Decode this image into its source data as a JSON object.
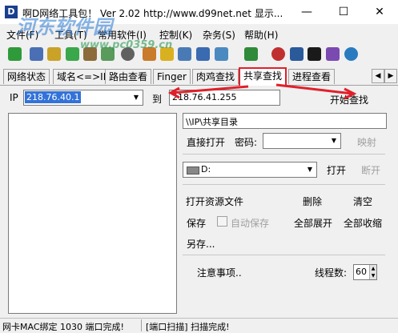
{
  "window": {
    "title": "啊D网络工具包！ Ver 2.02  http://www.d99net.net  显示...",
    "icon_letter": "D",
    "minimize": "—",
    "maximize": "☐",
    "close": "✕"
  },
  "watermark": {
    "main": "河东软件园",
    "sub": "www.pc0359.cn"
  },
  "menu": [
    "文件(F)",
    "工具(T)",
    "常用软件(I)",
    "控制(K)",
    "杂务(S)",
    "帮助(H)"
  ],
  "toolbar_icons": [
    "refresh-icon",
    "search-icon",
    "shield-icon",
    "check-icon",
    "tools-icon",
    "chart-icon",
    "globe-icon",
    "settings-icon",
    "key-icon",
    "user-search-icon",
    "network-icon",
    "monitor-icon",
    "chip-icon",
    "info-icon",
    "screen-icon",
    "console-icon",
    "pen-icon",
    "globe2-icon"
  ],
  "tabs": [
    "网络状态",
    "域名<=>IP",
    "路由查看",
    "Finger",
    "肉鸡查找",
    "共享查找",
    "进程查看"
  ],
  "ip_range": {
    "ip_label": "IP",
    "start_ip": "218.76.40.1",
    "to_label": "到",
    "end_ip": "218.76.41.255",
    "start_button": "开始查找"
  },
  "share_path": "\\\\IP\\共享目录",
  "direct_open": "直接打开",
  "password_label": "密码:",
  "map_button": "映射",
  "drive_value": "D:",
  "open_button": "打开",
  "disconnect_button": "断开",
  "actions": {
    "open_explorer": "打开资源文件",
    "delete": "删除",
    "clear": "清空",
    "save": "保存",
    "auto_save": "自动保存",
    "expand_all": "全部展开",
    "collapse_all": "全部收缩",
    "save_as": "另存..."
  },
  "notes_label": "注意事项..",
  "threads_label": "线程数:",
  "threads_value": "60",
  "status": {
    "left": "网卡MAC绑定 1030 端口完成!",
    "right": "[端口扫描] 扫描完成!"
  },
  "colors": {
    "accent_red": "#e0202a",
    "selection_blue": "#3373d9"
  }
}
